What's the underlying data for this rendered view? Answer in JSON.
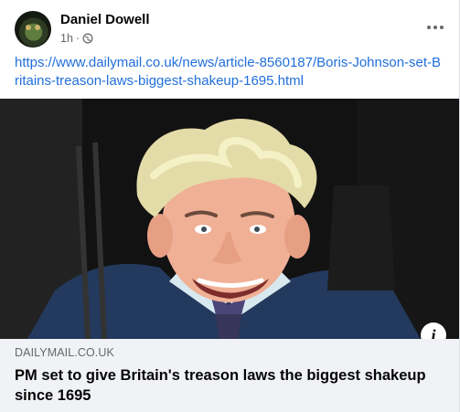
{
  "post": {
    "author": "Daniel Dowell",
    "time": "1h",
    "separator": "·",
    "privacy_icon": "globe-icon",
    "more_icon": "more-options-icon",
    "link_text": "https://www.dailymail.co.uk/news/article-8560187/Boris-Johnson-set-Britains-treason-laws-biggest-shakeup-1695.html"
  },
  "preview": {
    "domain": "DAILYMAIL.CO.UK",
    "headline": "PM set to give Britain's treason laws the biggest shakeup since 1695",
    "info_icon": "info-icon",
    "info_glyph": "i"
  },
  "colors": {
    "link": "#216fdb",
    "meta_text": "#65676b",
    "preview_bg": "#f0f2f5"
  }
}
